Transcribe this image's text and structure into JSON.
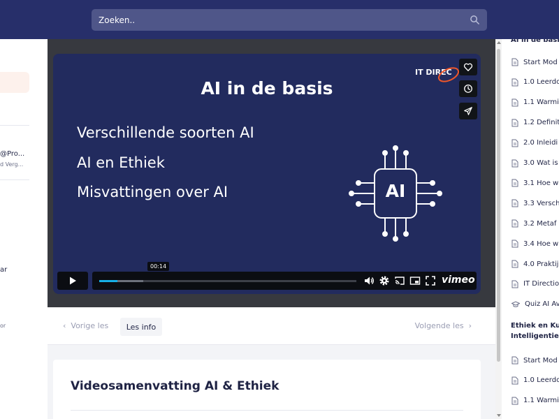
{
  "search": {
    "placeholder": "Zoeken.."
  },
  "left_sidebar": {
    "user_email": "@Pro...",
    "user_sub": "d Verg...",
    "item_a": "ar",
    "item_b": "or"
  },
  "video": {
    "slide_title": "AI in de basis",
    "bullets": [
      "Verschillende soorten AI",
      "AI en Ethiek",
      "Misvattingen over AI"
    ],
    "brand_text": "IT DIREC",
    "chip_label": "AI",
    "time_tooltip": "00:14",
    "progress_fraction": 0.07,
    "buffer_fraction": 0.17,
    "vimeo_label": "vimeo"
  },
  "lesson_nav": {
    "prev": "Vorige les",
    "info": "Les info",
    "next": "Volgende les"
  },
  "summary": {
    "title": "Videosamenvatting AI & Ethiek"
  },
  "right_sidebar": {
    "section1_title": "AI in de basis",
    "items": [
      {
        "label": "Start Mod",
        "icon": "document-icon"
      },
      {
        "label": "1.0 Leerdo",
        "icon": "document-icon"
      },
      {
        "label": "1.1 Warmin",
        "icon": "document-icon"
      },
      {
        "label": "1.2 Definit",
        "icon": "document-icon"
      },
      {
        "label": "2.0 Inleidi",
        "icon": "document-icon"
      },
      {
        "label": "3.0 Wat is",
        "icon": "document-icon"
      },
      {
        "label": "3.1 Hoe we",
        "icon": "document-icon"
      },
      {
        "label": "3.3 Versch",
        "icon": "document-icon"
      },
      {
        "label": "3.2 Metaf",
        "icon": "document-icon"
      },
      {
        "label": "3.4 Hoe w",
        "icon": "document-icon"
      },
      {
        "label": "4.0 Praktij",
        "icon": "document-icon"
      },
      {
        "label": "IT Directio",
        "icon": "document-icon"
      },
      {
        "label": "Quiz AI Av",
        "icon": "graduation-cap-icon"
      }
    ],
    "section2_title_line1": "Ethiek en Kun",
    "section2_title_line2": "Intelligentie",
    "items2": [
      {
        "label": "Start Mod",
        "icon": "document-icon"
      },
      {
        "label": "1.0 Leerdo",
        "icon": "document-icon"
      },
      {
        "label": "1.1 Warmin",
        "icon": "document-icon"
      }
    ]
  }
}
